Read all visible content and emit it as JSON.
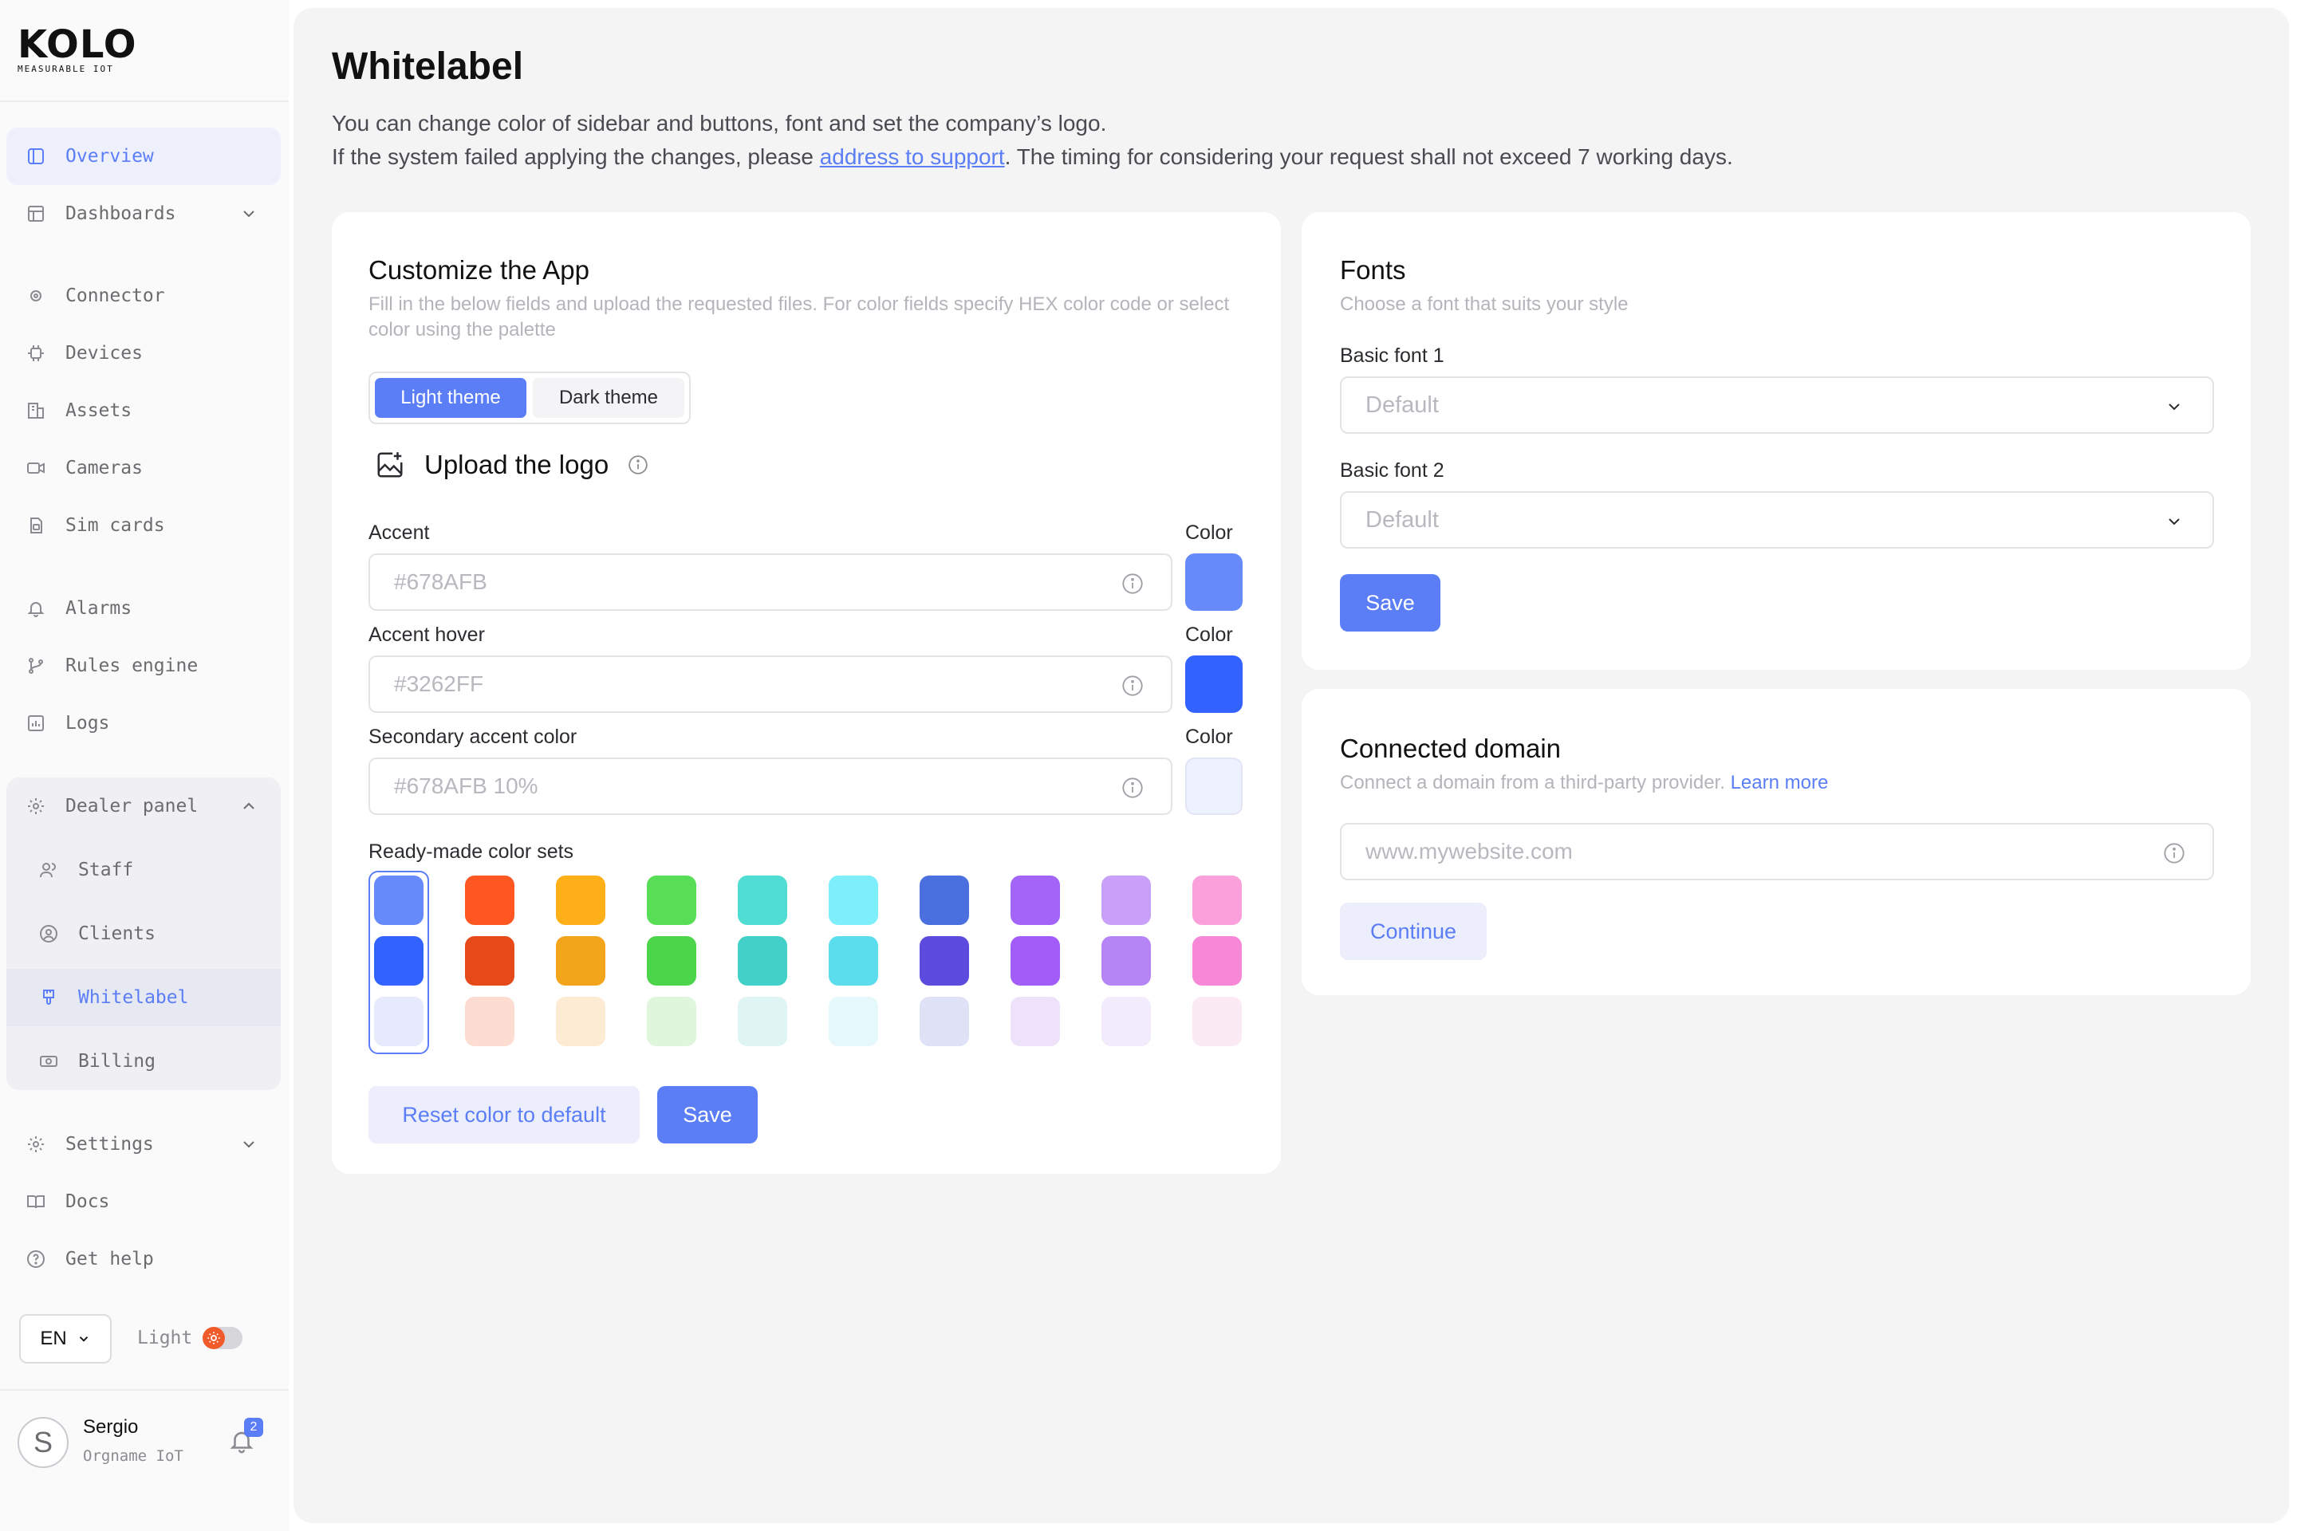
{
  "brand": {
    "logo": "KOLO",
    "tagline": "MEASURABLE IOT"
  },
  "sidebar": {
    "overview": "Overview",
    "dashboards": "Dashboards",
    "connector": "Connector",
    "devices": "Devices",
    "assets": "Assets",
    "cameras": "Cameras",
    "sim_cards": "Sim cards",
    "alarms": "Alarms",
    "rules_engine": "Rules engine",
    "logs": "Logs",
    "dealer_panel": "Dealer panel",
    "staff": "Staff",
    "clients": "Clients",
    "whitelabel": "Whitelabel",
    "billing": "Billing",
    "settings": "Settings",
    "docs": "Docs",
    "get_help": "Get help",
    "language": "EN",
    "theme_label": "Light",
    "user_initial": "S",
    "user_name": "Sergio",
    "user_org": "Orgname IoT",
    "notifications": "2"
  },
  "page": {
    "title": "Whitelabel",
    "desc_line1": "You can change color of sidebar and buttons, font and set the company’s logo.",
    "desc_line2_pre": "If the system failed applying the changes, please ",
    "desc_link": "address to support",
    "desc_line2_post": ". The timing for considering your request shall not exceed 7 working days."
  },
  "customize": {
    "title": "Customize the App",
    "subtitle": "Fill in the below fields and upload the requested files. For color fields specify HEX color code or select color using the palette",
    "tab_light": "Light theme",
    "tab_dark": "Dark theme",
    "upload_logo": "Upload the logo",
    "color_label": "Color",
    "accent_label": "Accent",
    "accent_placeholder": "#678AFB",
    "accent_hover_label": "Accent hover",
    "accent_hover_placeholder": "#3262FF",
    "secondary_label": "Secondary accent color",
    "secondary_placeholder": "#678AFB 10%",
    "sets_label": "Ready-made color sets",
    "reset_button": "Reset color to default",
    "save_button": "Save"
  },
  "colors": {
    "accent": "#678AFB",
    "accent_hover": "#3262FF",
    "secondary": "#EEF1FE"
  },
  "color_sets": [
    [
      "#678AFB",
      "#3262FF",
      "#E6EAFC"
    ],
    [
      "#FF5722",
      "#E64A19",
      "#FDDDD2"
    ],
    [
      "#FFB019",
      "#F2A51A",
      "#FDEBD3"
    ],
    [
      "#57DE56",
      "#4CD44B",
      "#DFF6DC"
    ],
    [
      "#4EDCD3",
      "#43D0C8",
      "#DFF5F3"
    ],
    [
      "#7EEEFB",
      "#5BDDEE",
      "#E5F8FB"
    ],
    [
      "#4A6FDE",
      "#5C4BDD",
      "#DFE2F7"
    ],
    [
      "#A265F7",
      "#A25CF8",
      "#EDE2FA"
    ],
    [
      "#C9A0F9",
      "#B585F5",
      "#F2EBFB"
    ],
    [
      "#FBA0DA",
      "#F788D7",
      "#FBEAF4"
    ]
  ],
  "fonts": {
    "title": "Fonts",
    "subtitle": "Choose a font that suits your style",
    "font1_label": "Basic font 1",
    "font1_value": "Default",
    "font2_label": "Basic font 2",
    "font2_value": "Default",
    "save_button": "Save"
  },
  "domain": {
    "title": "Connected domain",
    "subtitle": "Connect a domain from a third-party provider. ",
    "learn_more": "Learn more",
    "placeholder": "www.mywebsite.com",
    "continue_button": "Continue"
  }
}
